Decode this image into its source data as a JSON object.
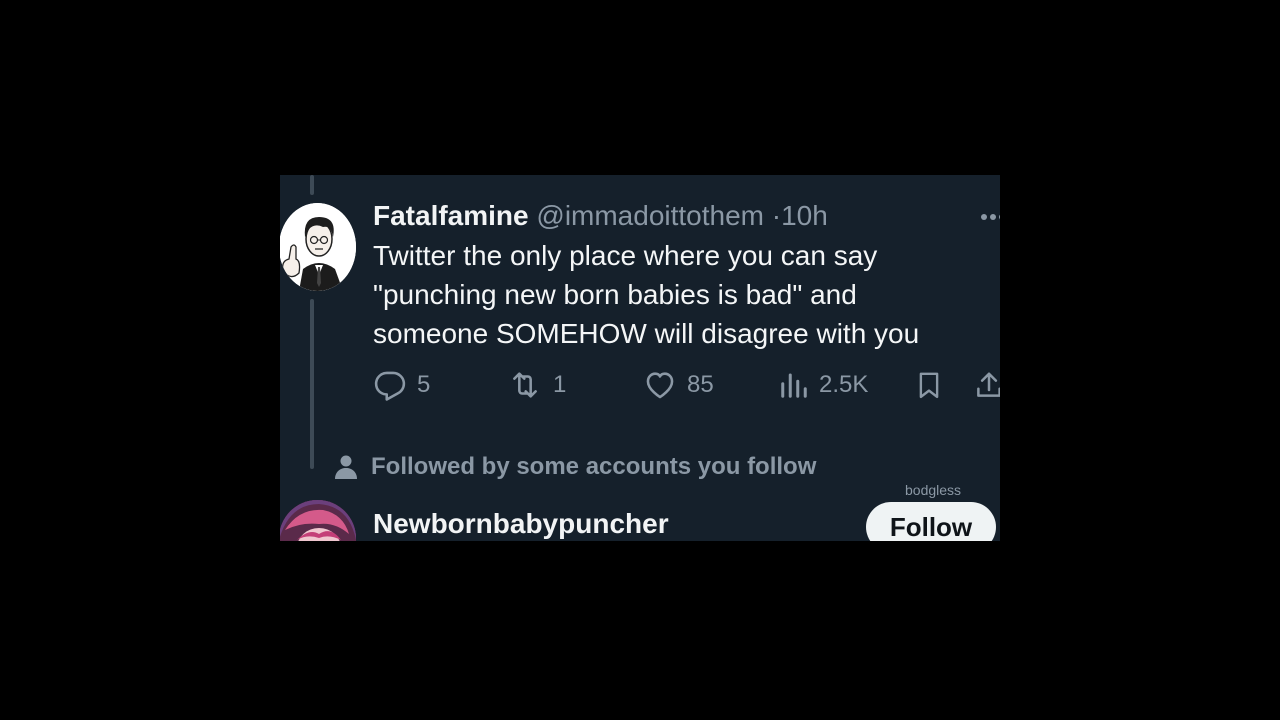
{
  "tweet": {
    "display_name": "Fatalfamine",
    "handle": "@immadoittothem",
    "separator": "·",
    "time": "10h",
    "text": "Twitter the only place where you can say \"punching new born babies is bad\" and someone SOMEHOW will disagree with you",
    "actions": {
      "replies": "5",
      "retweets": "1",
      "likes": "85",
      "views": "2.5K"
    }
  },
  "social_context": {
    "label": "Followed by some accounts you follow"
  },
  "watermark": "bodgless",
  "suggested_account": {
    "display_name": "Newbornbabypuncher",
    "follow_label": "Follow"
  },
  "colors": {
    "background": "#15202b",
    "text": "#f4f6f7",
    "muted": "#8b98a5",
    "button": "#eff3f4"
  },
  "icons": [
    "more-icon",
    "reply-icon",
    "retweet-icon",
    "like-icon",
    "views-icon",
    "bookmark-icon",
    "share-icon",
    "person-icon"
  ]
}
